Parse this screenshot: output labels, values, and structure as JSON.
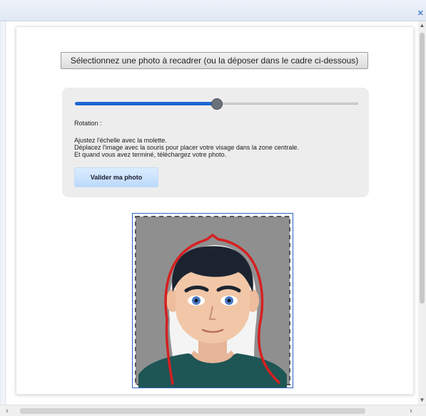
{
  "window": {
    "close_icon": "close-icon"
  },
  "uploader": {
    "select_label": "Sélectionnez une photo à recadrer (ou la déposer dans le cadre ci-dessous)",
    "scale_slider": {
      "value_percent": 50
    },
    "rotation_label": "Rotation :",
    "instructions": [
      "Ajustez l'échelle avec la molette.",
      "Déplacez l'image avec la souris pour placer votre visage dans la zone centrale.",
      "Et quand vous avez terminé, téléchargez votre photo."
    ],
    "validate_label": "Valider ma photo"
  },
  "preview": {
    "icon": "avatar-face",
    "colors": {
      "background": "#8f8f8f",
      "guide_outline": "#d62020",
      "shirt": "#1e5555",
      "hair": "#1c2330",
      "skin": "#f1c7a8"
    }
  },
  "colors": {
    "accent": "#1f66d1",
    "frame_border": "#2b63c6"
  }
}
